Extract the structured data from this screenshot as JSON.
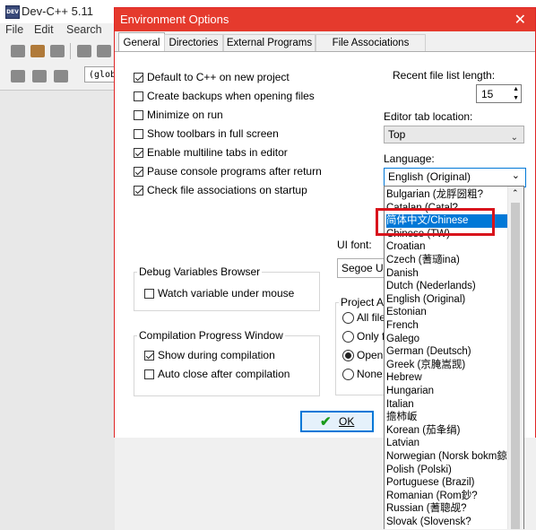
{
  "ide": {
    "title": "Dev-C++ 5.11",
    "logo_text": "DEV",
    "menu": [
      "File",
      "Edit",
      "Search"
    ],
    "scope_combo": "(glob"
  },
  "dialog": {
    "title": "Environment Options",
    "close_glyph": "✕",
    "tabs": [
      "General",
      "Directories",
      "External Programs",
      "File Associations"
    ],
    "checkboxes": [
      {
        "label": "Default to C++ on new project",
        "checked": true
      },
      {
        "label": "Create backups when opening files",
        "checked": false
      },
      {
        "label": "Minimize on run",
        "checked": false
      },
      {
        "label": "Show toolbars in full screen",
        "checked": false
      },
      {
        "label": "Enable multiline tabs in editor",
        "checked": true
      },
      {
        "label": "Pause console programs after return",
        "checked": true
      },
      {
        "label": "Check file associations on startup",
        "checked": true
      }
    ],
    "recent_label": "Recent file list length:",
    "recent_value": "15",
    "tab_location_label": "Editor tab location:",
    "tab_location_value": "Top",
    "language_label": "Language:",
    "language_value": "English (Original)",
    "ui_font_label": "UI font:",
    "ui_font_value": "Segoe UI",
    "debug_group": {
      "title": "Debug Variables Browser",
      "watch_label": "Watch variable under mouse",
      "checked": false
    },
    "progress_group": {
      "title": "Compilation Progress Window",
      "items": [
        {
          "label": "Show during compilation",
          "checked": true
        },
        {
          "label": "Auto close after compilation",
          "checked": false
        }
      ]
    },
    "project_group": {
      "title": "Project A",
      "options": [
        {
          "label": "All file",
          "selected": false
        },
        {
          "label": "Only f",
          "selected": false
        },
        {
          "label": "Open",
          "selected": true
        },
        {
          "label": "None",
          "selected": false
        }
      ]
    },
    "ok_label": "OK"
  },
  "language_list": [
    "Bulgarian (龙脬圀粗?",
    "Catalan (Catal?",
    "简体中文/Chinese",
    "Chinese (TW)",
    "Croatian",
    "Czech (蓍瓋ina)",
    "Danish",
    "Dutch (Nederlands)",
    "English (Original)",
    "Estonian",
    "French",
    "Galego",
    "German (Deutsch)",
    "Greek (京腌嵩觊)",
    "Hebrew",
    "Hungarian",
    "Italian",
    "擔柿岅",
    "Korean (茄夆绢)",
    "Latvian",
    "Norwegian (Norsk bokm鍄",
    "Polish (Polski)",
    "Portuguese (Brazil)",
    "Romanian (Rom鈔?",
    "Russian (蓍聰觇?",
    "Slovak (Slovensk?"
  ],
  "highlighted_index": 2,
  "colors": {
    "title_bar": "#e53a2d",
    "highlight": "#0078d7",
    "annotation_box": "#d8141c"
  }
}
